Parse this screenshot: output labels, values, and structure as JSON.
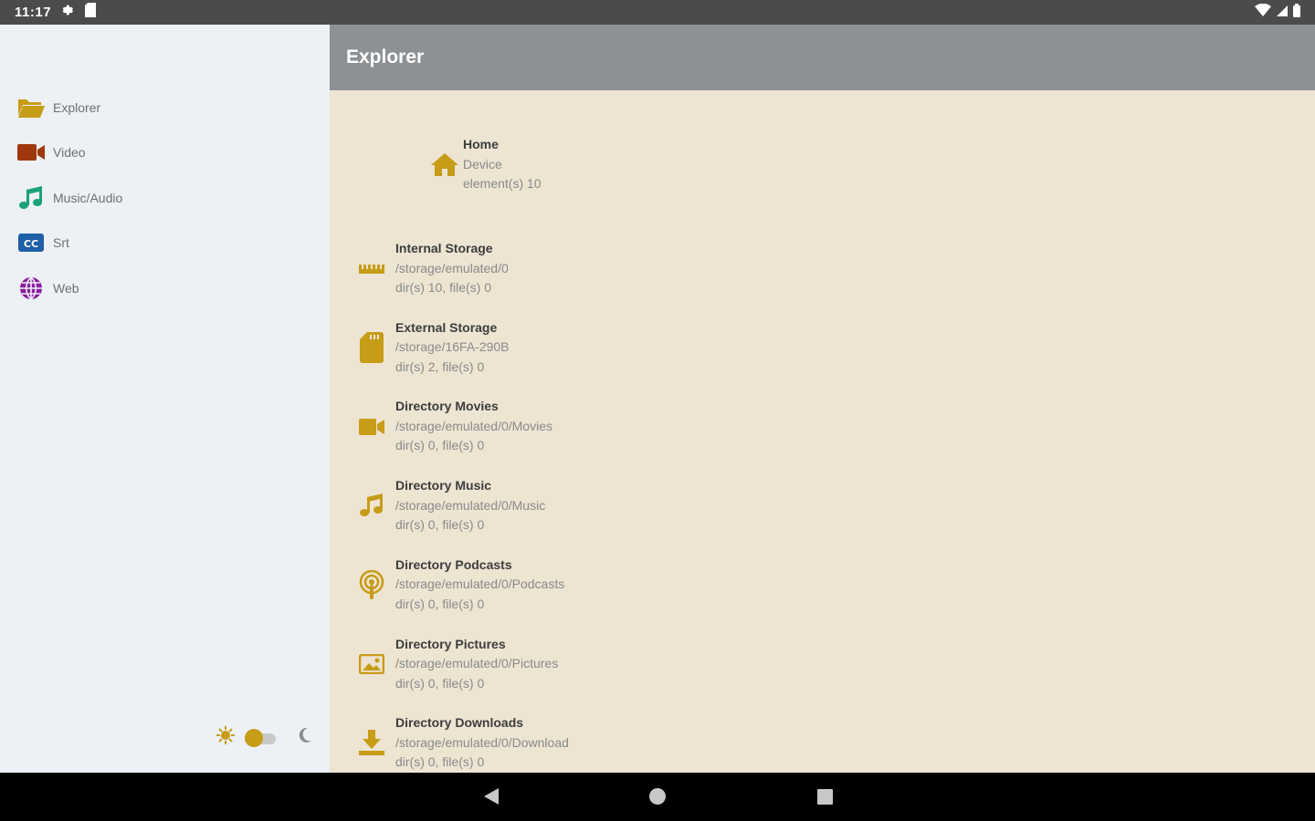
{
  "status_bar": {
    "time": "11:17",
    "left_icons": [
      "settings-icon",
      "sd-card-icon"
    ],
    "right_icons": [
      "wifi-icon",
      "cell-signal-icon",
      "battery-icon"
    ]
  },
  "drawer": {
    "items": [
      {
        "label": "Explorer",
        "icon": "folder-open-icon"
      },
      {
        "label": "Video",
        "icon": "video-camera-icon"
      },
      {
        "label": "Music/Audio",
        "icon": "music-note-icon"
      },
      {
        "label": "Srt",
        "icon": "closed-caption-icon"
      },
      {
        "label": "Web",
        "icon": "globe-icon"
      }
    ],
    "theme_toggle": {
      "light_icon": "sun-icon",
      "dark_icon": "moon-icon",
      "state": "light"
    }
  },
  "appbar": {
    "title": "Explorer"
  },
  "home": {
    "title": "Home",
    "subtitle": "Device",
    "detail": "element(s) 10"
  },
  "entries": [
    {
      "title": "Internal Storage",
      "path": "/storage/emulated/0",
      "counts": "dir(s) 10, file(s) 0",
      "icon": "storage-icon"
    },
    {
      "title": "External Storage",
      "path": "/storage/16FA-290B",
      "counts": "dir(s) 2, file(s) 0",
      "icon": "sd-card-icon"
    },
    {
      "title": "Directory Movies",
      "path": "/storage/emulated/0/Movies",
      "counts": "dir(s) 0, file(s) 0",
      "icon": "video-camera-icon"
    },
    {
      "title": "Directory Music",
      "path": "/storage/emulated/0/Music",
      "counts": "dir(s) 0, file(s) 0",
      "icon": "music-note-icon"
    },
    {
      "title": "Directory Podcasts",
      "path": "/storage/emulated/0/Podcasts",
      "counts": "dir(s) 0, file(s) 0",
      "icon": "podcast-icon"
    },
    {
      "title": "Directory Pictures",
      "path": "/storage/emulated/0/Pictures",
      "counts": "dir(s) 0, file(s) 0",
      "icon": "image-icon"
    },
    {
      "title": "Directory Downloads",
      "path": "/storage/emulated/0/Download",
      "counts": "dir(s) 0, file(s) 0",
      "icon": "download-icon"
    }
  ],
  "nav_bar": {
    "buttons": [
      "back-icon",
      "home-icon",
      "recents-icon"
    ]
  },
  "colors": {
    "accent": "#c79c17",
    "drawer_bg": "#edf0f4",
    "content_bg": "#ede4d2",
    "appbar_bg": "#8e9194",
    "status_bar_bg": "#4a4b4d",
    "video_icon": "#a0380f",
    "music_icon": "#1aa17a",
    "cc_icon": "#1d5fa8",
    "globe_icon": "#8a1fa0"
  }
}
